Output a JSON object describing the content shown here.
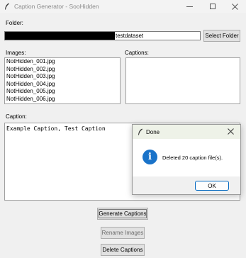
{
  "window": {
    "title": "Caption Generator - SooHidden",
    "minimize_icon": "minimize-icon",
    "maximize_icon": "maximize-icon",
    "close_icon": "close-icon"
  },
  "folder": {
    "label": "Folder:",
    "path_suffix": "testdataset",
    "select_button": "Select Folder"
  },
  "images": {
    "label": "Images:",
    "items": [
      "NotHidden_001.jpg",
      "NotHidden_002.jpg",
      "NotHidden_003.jpg",
      "NotHidden_004.jpg",
      "NotHidden_005.jpg",
      "NotHidden_006.jpg"
    ]
  },
  "captions": {
    "label": "Captions:",
    "items": []
  },
  "caption_editor": {
    "label": "Caption:",
    "text": "Example Caption, Test Caption"
  },
  "actions": {
    "generate": "Generate Captions",
    "rename": "Rename Images",
    "delete": "Delete Captions"
  },
  "dialog": {
    "title": "Done",
    "message": "Deleted 20 caption file(s).",
    "ok_button": "OK",
    "icon": "info-icon",
    "accent": "#1a73c9"
  }
}
